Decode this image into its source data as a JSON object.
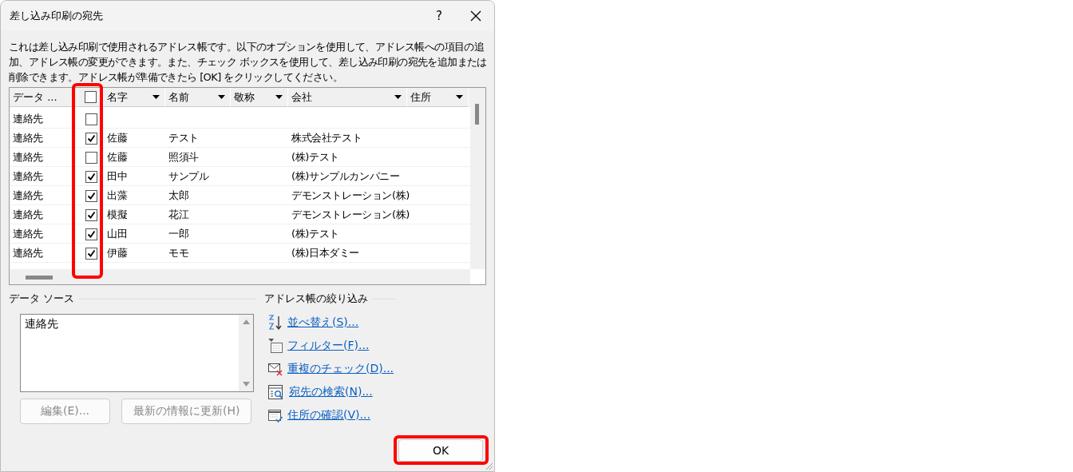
{
  "window": {
    "title": "差し込み印刷の宛先",
    "help": "?"
  },
  "description": "これは差し込み印刷で使用されるアドレス帳です。以下のオプションを使用して、アドレス帳への項目の追加、アドレス帳の変更ができます。また、チェック ボックスを使用して、差し込み印刷の宛先を追加または削除できます。アドレス帳が準備できたら [OK] をクリックしてください。",
  "table": {
    "source_column": "データ ...",
    "header_checked": false,
    "columns": [
      {
        "label": "名字",
        "dropdown": true
      },
      {
        "label": "名前",
        "dropdown": true
      },
      {
        "label": "敬称",
        "dropdown": true
      },
      {
        "label": "会社",
        "dropdown": true
      },
      {
        "label": "住所",
        "dropdown": true
      }
    ],
    "rows": [
      {
        "source": "連絡先",
        "checked": false,
        "cells": [
          null,
          null,
          null,
          null,
          null
        ]
      },
      {
        "source": "連絡先",
        "checked": true,
        "cells": [
          "佐藤",
          "テスト",
          null,
          "株式会社テスト",
          null
        ]
      },
      {
        "source": "連絡先",
        "checked": false,
        "cells": [
          "佐藤",
          "照須斗",
          null,
          "(株)テスト",
          null
        ]
      },
      {
        "source": "連絡先",
        "checked": true,
        "cells": [
          "田中",
          "サンプル",
          null,
          "(株)サンプルカンパニー",
          null
        ]
      },
      {
        "source": "連絡先",
        "checked": true,
        "cells": [
          "出藻",
          "太郎",
          null,
          "デモンストレーション(株)",
          null
        ]
      },
      {
        "source": "連絡先",
        "checked": true,
        "cells": [
          "模擬",
          "花江",
          null,
          "デモンストレーション(株)",
          null
        ]
      },
      {
        "source": "連絡先",
        "checked": true,
        "cells": [
          "山田",
          "一郎",
          null,
          "(株)テスト",
          null
        ]
      },
      {
        "source": "連絡先",
        "checked": true,
        "cells": [
          "伊藤",
          "モモ",
          null,
          "(株)日本ダミー",
          null
        ]
      }
    ]
  },
  "data_source": {
    "title": "データ ソース",
    "items": [
      "連絡先"
    ],
    "buttons": [
      {
        "label": "編集(E)...",
        "disabled": true
      },
      {
        "label": "最新の情報に更新(H)",
        "disabled": true
      }
    ]
  },
  "refine": {
    "title": "アドレス帳の絞り込み",
    "links": [
      {
        "label": "並べ替え(S)...",
        "kind": "sort"
      },
      {
        "label": "フィルター(F)...",
        "kind": "filter"
      },
      {
        "label": "重複のチェック(D)...",
        "kind": "duplicates"
      },
      {
        "label": "宛先の検索(N)...",
        "kind": "find"
      },
      {
        "label": "住所の確認(V)...",
        "kind": "validate"
      }
    ]
  },
  "ok_button": {
    "label": "OK"
  }
}
